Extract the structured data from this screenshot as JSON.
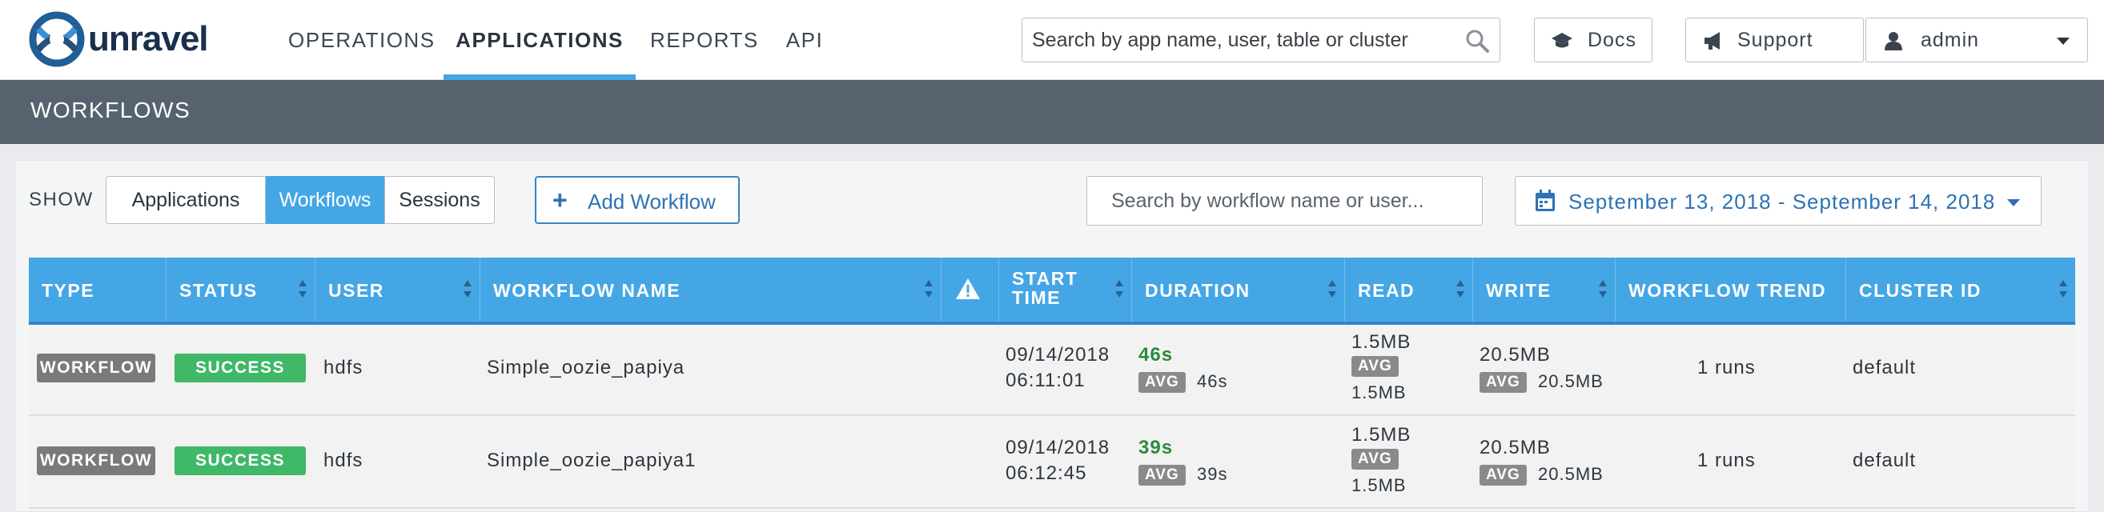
{
  "brand": {
    "name": "unravel"
  },
  "nav": {
    "items": [
      {
        "label": "OPERATIONS"
      },
      {
        "label": "APPLICATIONS"
      },
      {
        "label": "REPORTS"
      },
      {
        "label": "API"
      }
    ],
    "active": "APPLICATIONS"
  },
  "top_search": {
    "placeholder": "Search by app name, user, table or cluster"
  },
  "top_buttons": {
    "docs": "Docs",
    "support": "Support",
    "user": "admin"
  },
  "section": {
    "title": "WORKFLOWS"
  },
  "toolbar": {
    "show_label": "SHOW",
    "segments": [
      "Applications",
      "Workflows",
      "Sessions"
    ],
    "active_segment": "Workflows",
    "add_label": "Add Workflow",
    "search_placeholder": "Search by workflow name or user...",
    "date_range": "September 13, 2018 - September 14, 2018"
  },
  "table": {
    "columns": [
      "TYPE",
      "STATUS",
      "USER",
      "WORKFLOW NAME",
      "",
      "START TIME",
      "DURATION",
      "READ",
      "WRITE",
      "WORKFLOW TREND",
      "CLUSTER ID"
    ],
    "start_time_label": [
      "START",
      "TIME"
    ],
    "avg_label": "AVG",
    "rows": [
      {
        "type": "WORKFLOW",
        "status": "SUCCESS",
        "user": "hdfs",
        "name": "Simple_oozie_papiya",
        "start_date": "09/14/2018",
        "start_time": "06:11:01",
        "duration": "46s",
        "duration_avg": "46s",
        "read": "1.5MB",
        "read_avg": "1.5MB",
        "write": "20.5MB",
        "write_avg": "20.5MB",
        "trend": "1 runs",
        "cluster": "default"
      },
      {
        "type": "WORKFLOW",
        "status": "SUCCESS",
        "user": "hdfs",
        "name": "Simple_oozie_papiya1",
        "start_date": "09/14/2018",
        "start_time": "06:12:45",
        "duration": "39s",
        "duration_avg": "39s",
        "read": "1.5MB",
        "read_avg": "1.5MB",
        "write": "20.5MB",
        "write_avg": "20.5MB",
        "trend": "1 runs",
        "cluster": "default"
      }
    ]
  },
  "colors": {
    "accent": "#45a6e6",
    "header_bar": "#56636e",
    "success": "#3fb868",
    "type_badge": "#7a7a7a",
    "duration_text": "#2e8a3c"
  }
}
